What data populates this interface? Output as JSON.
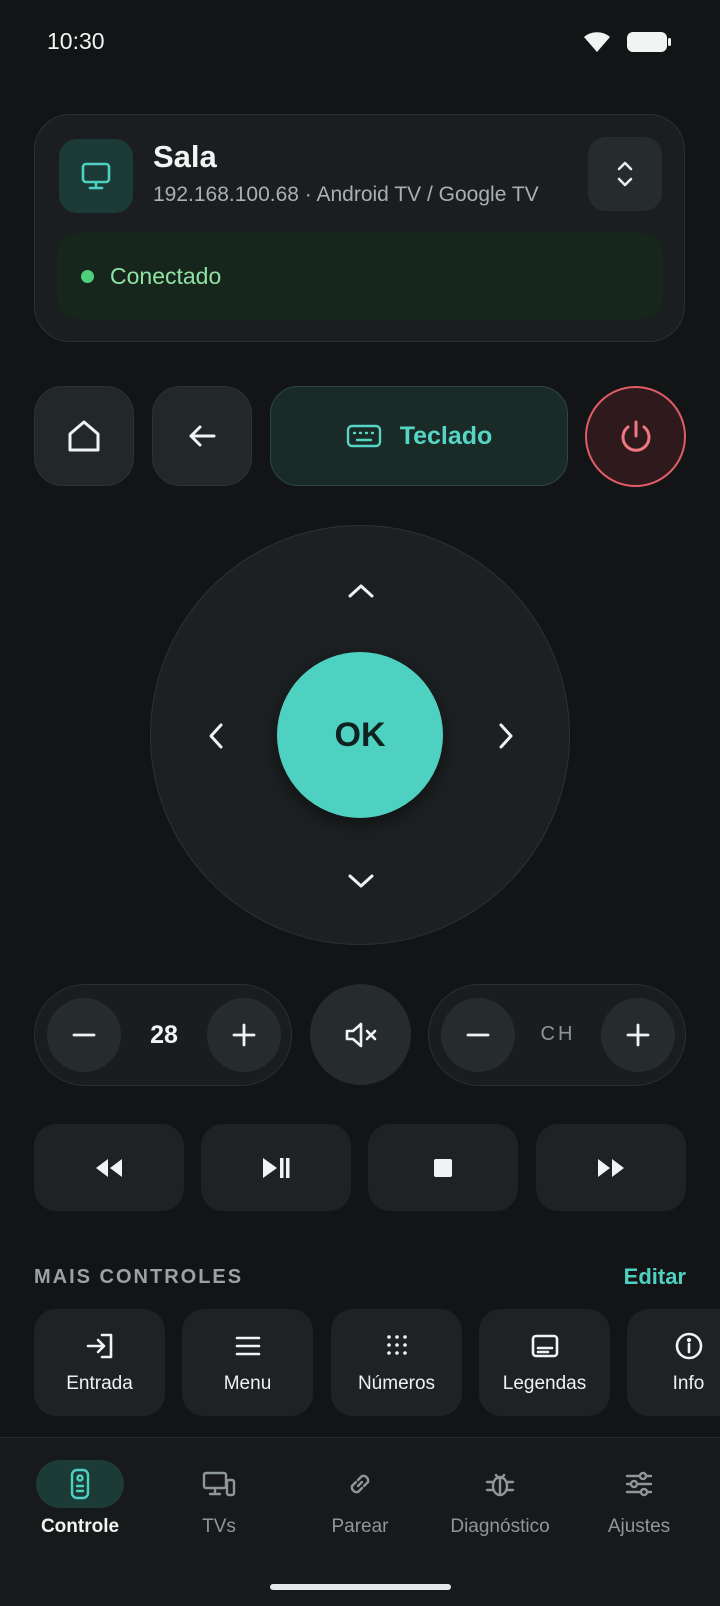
{
  "status_bar": {
    "time": "10:30"
  },
  "device": {
    "name": "Sala",
    "subtitle": "192.168.100.68 · Android TV / Google TV",
    "status": "Conectado"
  },
  "top_row": {
    "keyboard_label": "Teclado"
  },
  "dpad": {
    "ok_label": "OK"
  },
  "volume": {
    "value": "28"
  },
  "channel": {
    "label": "CH"
  },
  "more_controls": {
    "title": "MAIS CONTROLES",
    "edit_label": "Editar",
    "items": [
      {
        "label": "Entrada",
        "icon": "input-icon"
      },
      {
        "label": "Menu",
        "icon": "menu-icon"
      },
      {
        "label": "Números",
        "icon": "numbers-icon"
      },
      {
        "label": "Legendas",
        "icon": "subtitles-icon"
      },
      {
        "label": "Info",
        "icon": "info-icon"
      }
    ]
  },
  "nav": {
    "items": [
      {
        "label": "Controle",
        "icon": "remote-icon",
        "active": true
      },
      {
        "label": "TVs",
        "icon": "devices-icon",
        "active": false
      },
      {
        "label": "Parear",
        "icon": "link-icon",
        "active": false
      },
      {
        "label": "Diagnóstico",
        "icon": "bug-icon",
        "active": false
      },
      {
        "label": "Ajustes",
        "icon": "sliders-icon",
        "active": false
      }
    ]
  },
  "colors": {
    "accent": "#4fd1c2",
    "power": "#e05c66",
    "connected": "#4fcf7a",
    "background": "#121416"
  }
}
